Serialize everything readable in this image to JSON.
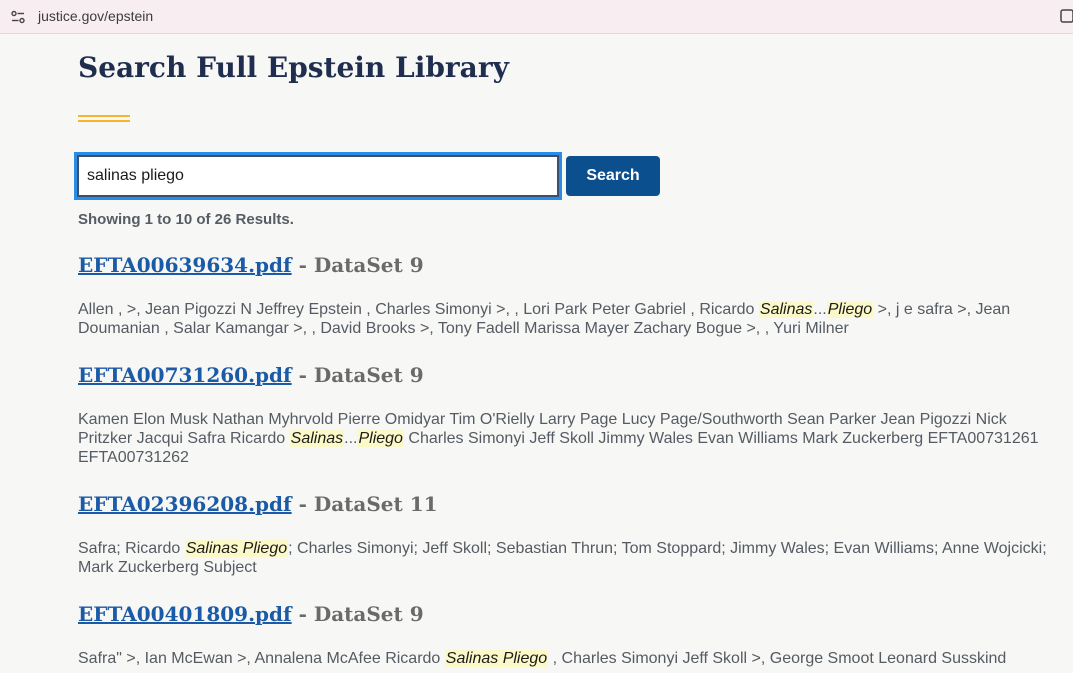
{
  "browser": {
    "url": "justice.gov/epstein"
  },
  "page": {
    "title": "Search Full Epstein Library"
  },
  "search": {
    "value": "salinas pliego",
    "button_label": "Search"
  },
  "results_summary": "Showing 1 to 10 of 26 Results.",
  "results": [
    {
      "file": "EFTA00639634.pdf",
      "dataset": " - DataSet 9",
      "snippet": [
        {
          "t": "Allen , >, Jean Pigozzi N Jeffrey Epstein , Charles Simonyi >, , Lori Park Peter Gabriel , Ricardo ",
          "h": false
        },
        {
          "t": "Salinas",
          "h": true
        },
        {
          "t": "...",
          "h": false
        },
        {
          "t": "Pliego",
          "h": true
        },
        {
          "t": " >, j e safra >, Jean Doumanian , Salar Kamangar >, , David Brooks >, Tony Fadell Marissa Mayer Zachary Bogue >, , Yuri Milner",
          "h": false
        }
      ]
    },
    {
      "file": "EFTA00731260.pdf",
      "dataset": " - DataSet 9",
      "snippet": [
        {
          "t": "Kamen Elon Musk Nathan Myhrvold Pierre Omidyar Tim O'Rielly Larry Page Lucy Page/Southworth Sean Parker Jean Pigozzi Nick Pritzker Jacqui Safra Ricardo ",
          "h": false
        },
        {
          "t": "Salinas",
          "h": true
        },
        {
          "t": "...",
          "h": false
        },
        {
          "t": "Pliego",
          "h": true
        },
        {
          "t": " Charles Simonyi Jeff Skoll Jimmy Wales Evan Williams Mark Zuckerberg EFTA00731261 EFTA00731262",
          "h": false
        }
      ]
    },
    {
      "file": "EFTA02396208.pdf",
      "dataset": " - DataSet 11",
      "snippet": [
        {
          "t": "Safra; Ricardo ",
          "h": false
        },
        {
          "t": "Salinas Pliego",
          "h": true
        },
        {
          "t": "; Charles Simonyi; Jeff Skoll; Sebastian Thrun; Tom Stoppard; Jimmy Wales; Evan Williams; Anne Wojcicki; Mark Zuckerberg Subject",
          "h": false
        }
      ]
    },
    {
      "file": "EFTA00401809.pdf",
      "dataset": " - DataSet 9",
      "snippet": [
        {
          "t": "Safra\" >, Ian McEwan >, Annalena McAfee Ricardo ",
          "h": false
        },
        {
          "t": "Salinas Pliego",
          "h": true
        },
        {
          "t": " , Charles Simonyi Jeff Skoll >, George Smoot Leonard Susskind",
          "h": false
        }
      ]
    }
  ]
}
